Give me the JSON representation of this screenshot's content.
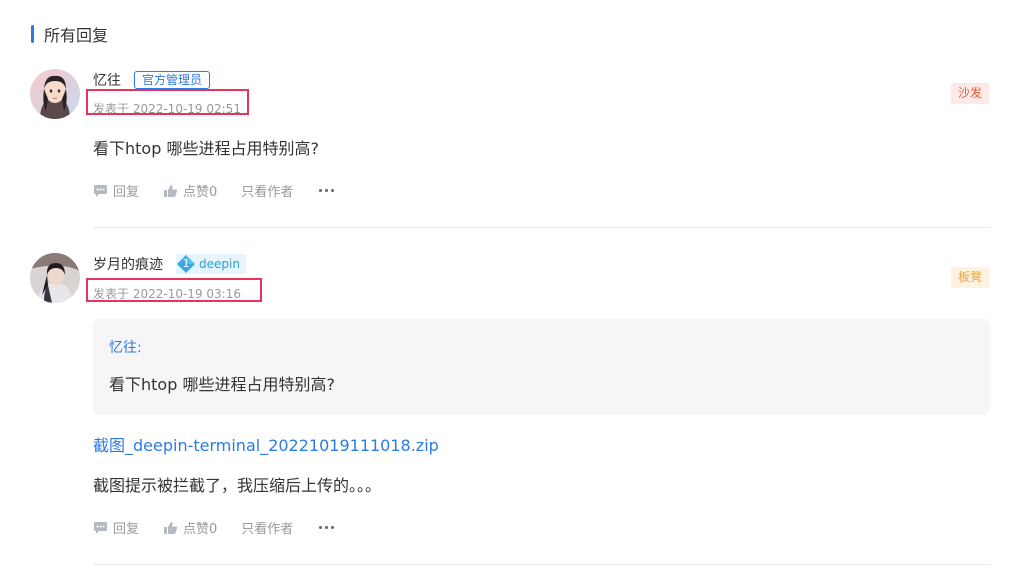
{
  "section": {
    "title": "所有回复"
  },
  "replies": [
    {
      "username": "忆往",
      "badge": "官方管理员",
      "time": "发表于 2022-10-19 02:51",
      "floor": "沙发",
      "content": "看下htop 哪些进程占用特别高?",
      "actions": {
        "reply": "回复",
        "like": "点赞0",
        "author_only": "只看作者"
      }
    },
    {
      "username": "岁月的痕迹",
      "level": "1",
      "level_label": "deepin",
      "time": "发表于 2022-10-19 03:16",
      "floor": "板凳",
      "quote": {
        "author": "忆往:",
        "text": "看下htop 哪些进程占用特别高?"
      },
      "attachment": "截图_deepin-terminal_20221019111018.zip",
      "content": "截图提示被拦截了，我压缩后上传的。。。",
      "actions": {
        "reply": "回复",
        "like": "点赞0",
        "author_only": "只看作者"
      }
    }
  ],
  "colors": {
    "accent": "#2c7be5",
    "highlight": "#e8335a"
  }
}
